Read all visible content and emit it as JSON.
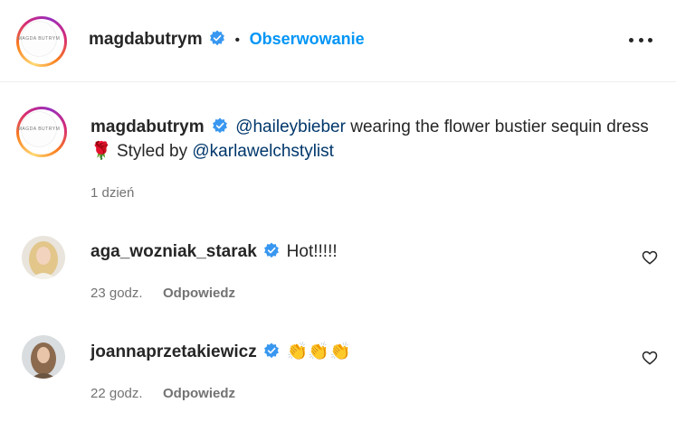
{
  "header": {
    "username": "magdabutrym",
    "separator": "•",
    "follow_label": "Obserwowanie",
    "avatar_logo_text": "MAGDA BUTRYM"
  },
  "caption": {
    "username": "magdabutrym",
    "mention1": "@haileybieber",
    "text1": " wearing the flower bustier sequin dress ",
    "emoji": "🌹",
    "text2": " Styled by ",
    "mention2": "@karlawelchstylist",
    "time": "1 dzień"
  },
  "comments": [
    {
      "username": "aga_wozniak_starak",
      "text": "Hot!!!!!",
      "time": "23 godz.",
      "reply_label": "Odpowiedz"
    },
    {
      "username": "joannaprzetakiewicz",
      "text": "👏👏👏",
      "time": "22 godz.",
      "reply_label": "Odpowiedz"
    }
  ],
  "colors": {
    "accent": "#0095f6",
    "mention": "#00376b",
    "verified": "#3897f0",
    "muted": "#737373"
  },
  "icons": [
    "verified-badge-icon",
    "more-options-icon",
    "heart-icon"
  ]
}
